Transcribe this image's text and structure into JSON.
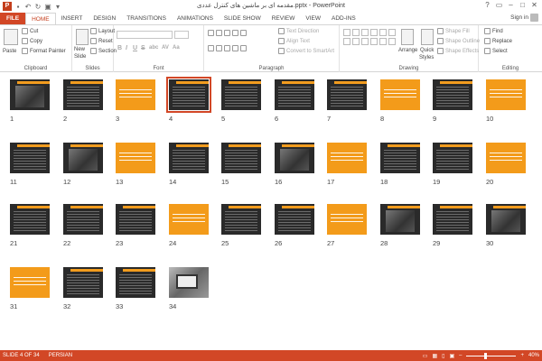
{
  "window": {
    "title": "مقدمه ای بر ماشین های کنترل عددی.pptx - PowerPoint",
    "app_icon": "P",
    "controls": [
      "?",
      "▭",
      "–",
      "□",
      "✕"
    ]
  },
  "tabs": [
    "FILE",
    "HOME",
    "INSERT",
    "DESIGN",
    "TRANSITIONS",
    "ANIMATIONS",
    "SLIDE SHOW",
    "REVIEW",
    "VIEW",
    "ADD-INS"
  ],
  "active_tab": "HOME",
  "user": {
    "label": "Sign in"
  },
  "ribbon": {
    "clipboard": {
      "label": "Clipboard",
      "paste": "Paste",
      "cut": "Cut",
      "copy": "Copy",
      "format_painter": "Format Painter"
    },
    "slides": {
      "label": "Slides",
      "new_slide_1": "New",
      "new_slide_2": "Slide",
      "layout": "Layout",
      "reset": "Reset",
      "section": "Section"
    },
    "font": {
      "label": "Font",
      "bold": "B",
      "italic": "I",
      "underline": "U",
      "strike": "S",
      "shadow": "abc",
      "spacing": "AV",
      "case": "Aa"
    },
    "paragraph": {
      "label": "Paragraph",
      "text_direction": "Text Direction",
      "align_text": "Align Text",
      "convert_smartart": "Convert to SmartArt"
    },
    "drawing": {
      "label": "Drawing",
      "arrange": "Arrange",
      "quick_styles_1": "Quick",
      "quick_styles_2": "Styles",
      "shape_fill": "Shape Fill",
      "shape_outline": "Shape Outline",
      "shape_effects": "Shape Effects"
    },
    "editing": {
      "label": "Editing",
      "find": "Find",
      "replace": "Replace",
      "select": "Select"
    }
  },
  "slides": [
    {
      "n": "1",
      "style": "dark-img"
    },
    {
      "n": "2",
      "style": "dark"
    },
    {
      "n": "3",
      "style": "orange"
    },
    {
      "n": "4",
      "style": "dark",
      "selected": true
    },
    {
      "n": "5",
      "style": "dark"
    },
    {
      "n": "6",
      "style": "dark"
    },
    {
      "n": "7",
      "style": "dark"
    },
    {
      "n": "8",
      "style": "orange"
    },
    {
      "n": "9",
      "style": "dark"
    },
    {
      "n": "10",
      "style": "orange"
    },
    {
      "n": "11",
      "style": "dark"
    },
    {
      "n": "12",
      "style": "dark-img"
    },
    {
      "n": "13",
      "style": "orange"
    },
    {
      "n": "14",
      "style": "dark"
    },
    {
      "n": "15",
      "style": "dark"
    },
    {
      "n": "16",
      "style": "dark-img"
    },
    {
      "n": "17",
      "style": "orange"
    },
    {
      "n": "18",
      "style": "dark"
    },
    {
      "n": "19",
      "style": "dark"
    },
    {
      "n": "20",
      "style": "orange"
    },
    {
      "n": "21",
      "style": "dark"
    },
    {
      "n": "22",
      "style": "dark"
    },
    {
      "n": "23",
      "style": "dark"
    },
    {
      "n": "24",
      "style": "orange"
    },
    {
      "n": "25",
      "style": "dark"
    },
    {
      "n": "26",
      "style": "dark"
    },
    {
      "n": "27",
      "style": "orange"
    },
    {
      "n": "28",
      "style": "dark-img"
    },
    {
      "n": "29",
      "style": "dark"
    },
    {
      "n": "30",
      "style": "dark-img"
    },
    {
      "n": "31",
      "style": "orange"
    },
    {
      "n": "32",
      "style": "dark"
    },
    {
      "n": "33",
      "style": "dark"
    },
    {
      "n": "34",
      "style": "photo"
    }
  ],
  "status": {
    "slide_info": "SLIDE 4 OF 34",
    "language": "PERSIAN",
    "zoom": "40%",
    "zoom_minus": "–",
    "zoom_plus": "+"
  },
  "colors": {
    "accent": "#d24726",
    "slide_orange": "#f39b1a",
    "slide_dark": "#2a2a2a"
  }
}
